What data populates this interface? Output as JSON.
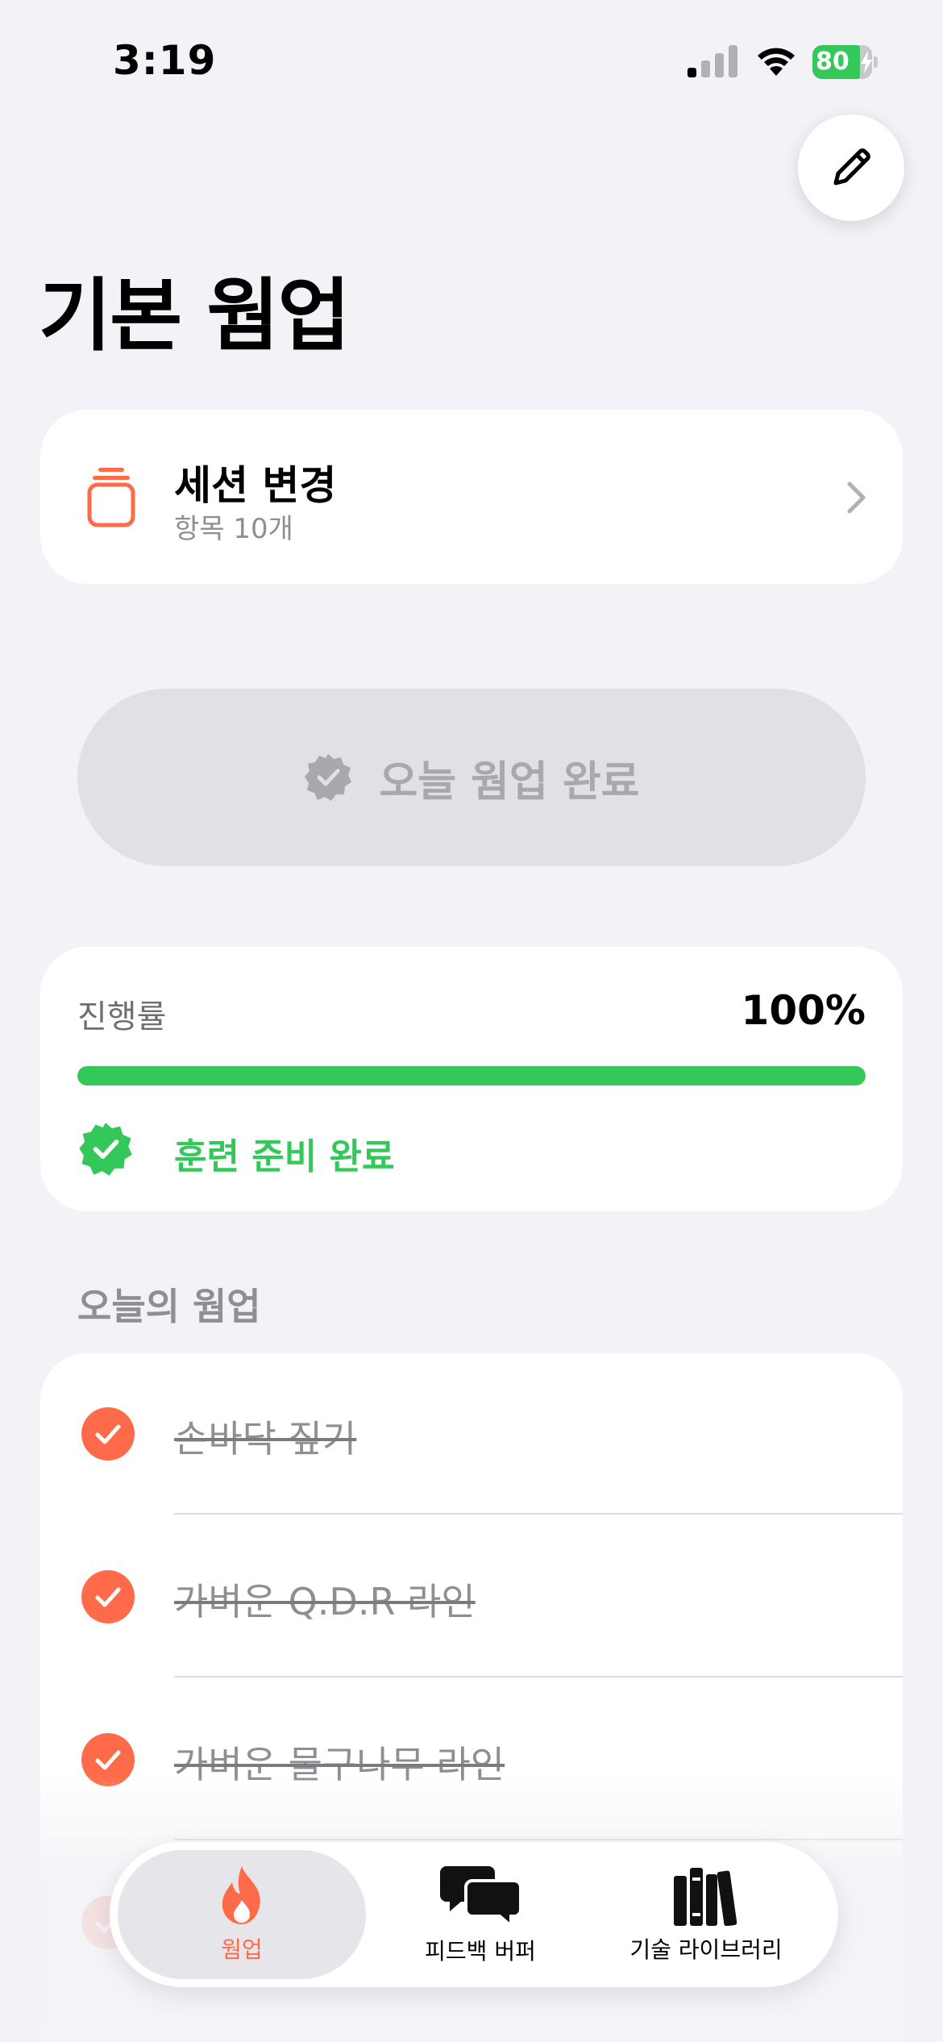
{
  "status_bar": {
    "time": "3:19",
    "battery_level": "80"
  },
  "header": {
    "title": "기본 웜업",
    "edit_icon": "pencil-icon"
  },
  "session": {
    "title": "세션 변경",
    "subtitle": "항목 10개",
    "icon": "stack-icon"
  },
  "complete_button": {
    "label": "오늘 웜업 완료"
  },
  "progress": {
    "label": "진행률",
    "value_text": "100%",
    "value": 100,
    "status": "훈련 준비 완료"
  },
  "today_list": {
    "header": "오늘의 웜업",
    "items": [
      {
        "label": "손바닥 짚기",
        "done": true
      },
      {
        "label": "가벼운 Q.D.R 라인",
        "done": true
      },
      {
        "label": "가벼운 물구나무 라인",
        "done": true
      }
    ]
  },
  "tab_bar": {
    "tabs": [
      {
        "label": "웜업",
        "icon": "flame-icon",
        "active": true
      },
      {
        "label": "피드백 버퍼",
        "icon": "chat-bubbles-icon",
        "active": false
      },
      {
        "label": "기술 라이브러리",
        "icon": "books-icon",
        "active": false
      }
    ]
  },
  "colors": {
    "accent": "#ff6b4a",
    "success": "#34c759",
    "background": "#f2f2f7"
  }
}
